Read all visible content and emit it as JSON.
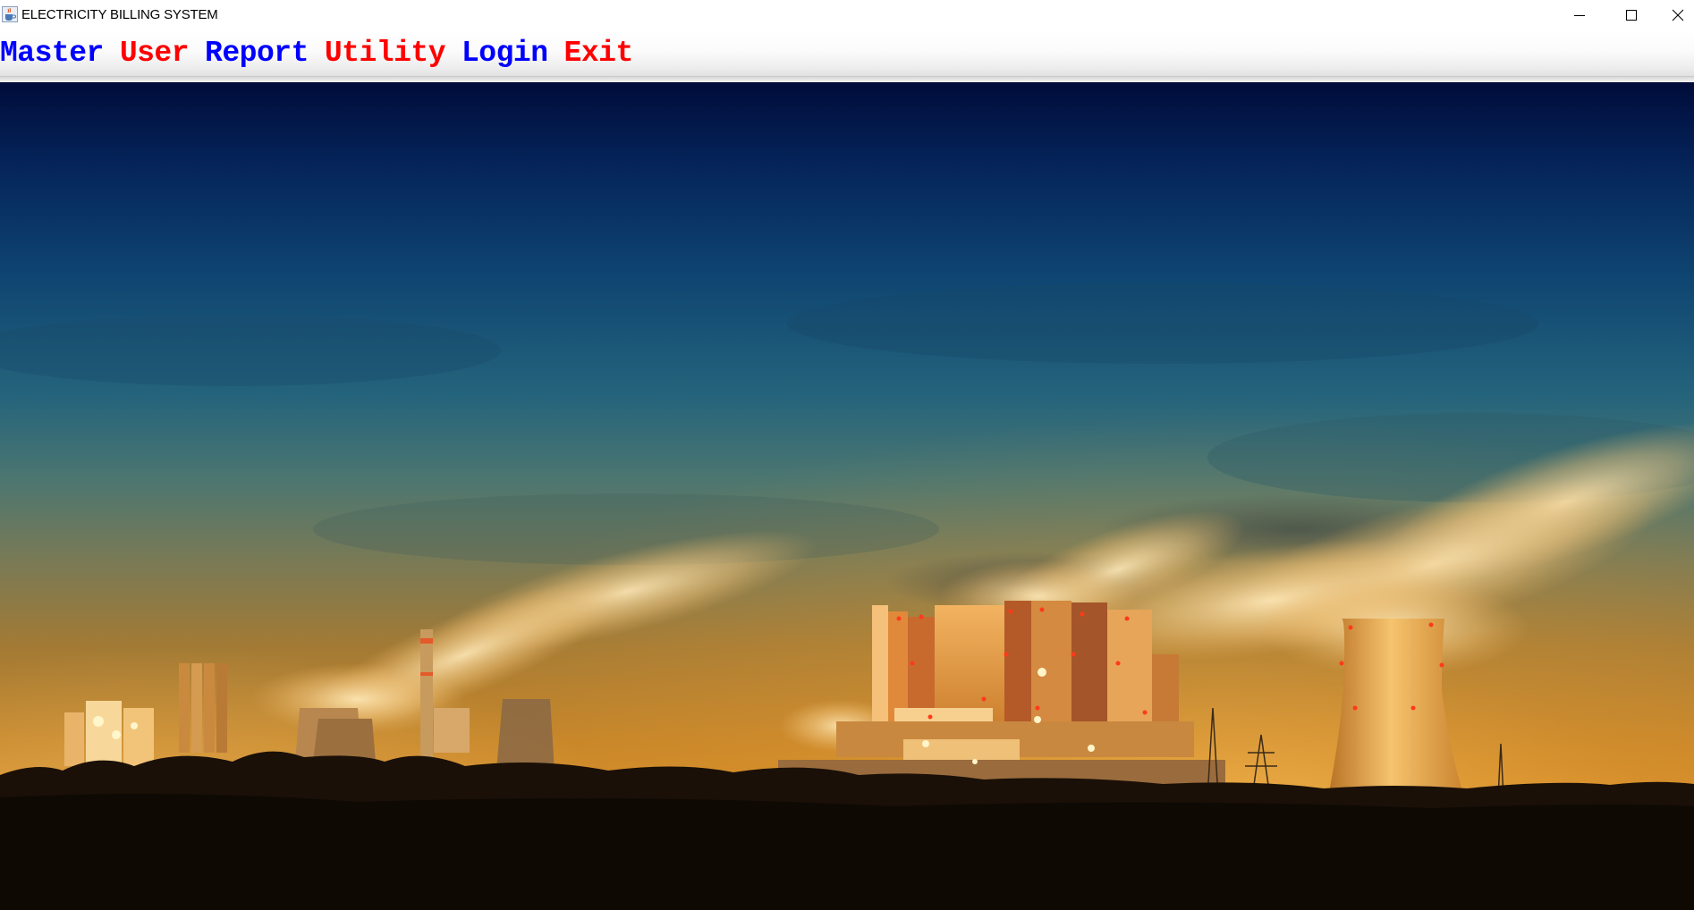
{
  "window": {
    "title": "ELECTRICITY BILLING SYSTEM",
    "app_icon": "java-cup-icon",
    "controls": {
      "minimize": "minimize-icon",
      "maximize": "maximize-icon",
      "close": "close-icon"
    }
  },
  "menu": {
    "items": [
      {
        "label": "Master",
        "color": "#0000ff"
      },
      {
        "label": "User",
        "color": "#ff0000"
      },
      {
        "label": "Report",
        "color": "#0000ff"
      },
      {
        "label": "Utility",
        "color": "#ff0000"
      },
      {
        "label": "Login",
        "color": "#0000ff"
      },
      {
        "label": "Exit",
        "color": "#ff0000"
      }
    ]
  },
  "background": {
    "description_icon": "power-plant-night-image",
    "colors": {
      "sky_top": "#000c3a",
      "sky_mid": "#1e5e7e",
      "horizon": "#c8801f",
      "glow": "#ffb347"
    }
  }
}
